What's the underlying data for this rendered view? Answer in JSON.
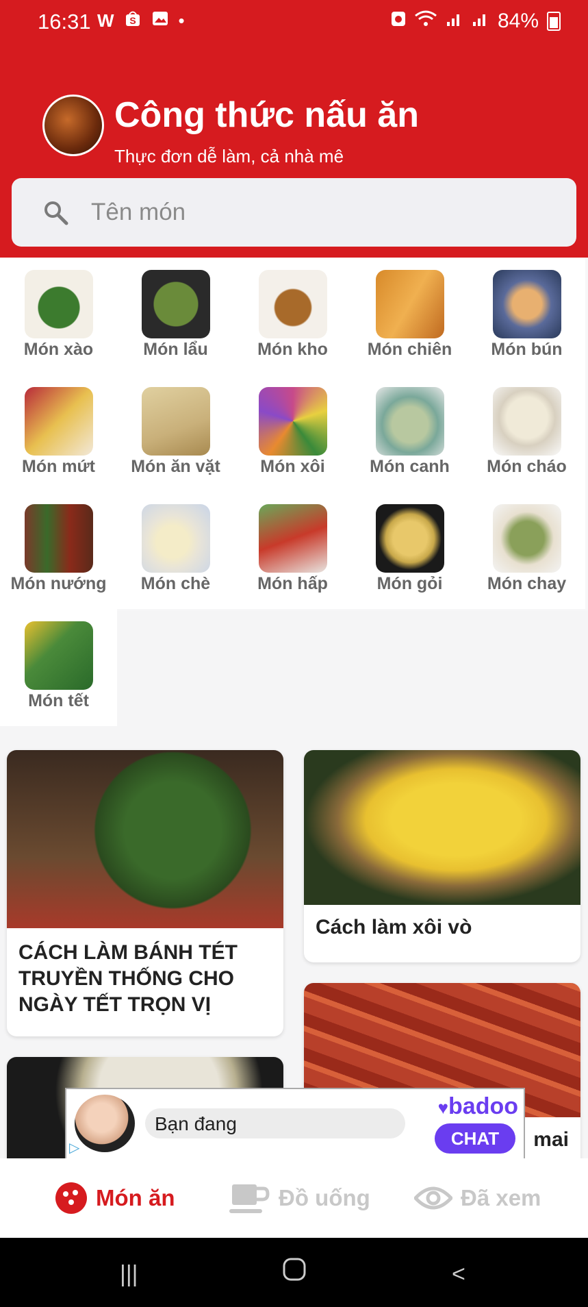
{
  "status": {
    "time": "16:31",
    "battery": "84%",
    "left_icons": [
      "W",
      "shop-icon",
      "image-icon",
      "dot-icon"
    ],
    "right_icons": [
      "alarm-icon",
      "wifi-icon",
      "signal-icon",
      "signal-icon"
    ]
  },
  "app": {
    "title": "Công thức nấu ăn",
    "subtitle": "Thực đơn dễ làm, cả nhà mê"
  },
  "search": {
    "placeholder": "Tên món"
  },
  "categories": [
    {
      "label": "Món xào",
      "color": "#3c7b2e"
    },
    {
      "label": "Món lẩu",
      "color": "#6a8b3a"
    },
    {
      "label": "Món kho",
      "color": "#a86a2a"
    },
    {
      "label": "Món chiên",
      "color": "#d88a2a"
    },
    {
      "label": "Món bún",
      "color": "#5a6a9a"
    },
    {
      "label": "Món mứt",
      "color": "#b82a3a"
    },
    {
      "label": "Món ăn vặt",
      "color": "#c9b07a"
    },
    {
      "label": "Món xôi",
      "color": "#c74a8a"
    },
    {
      "label": "Món canh",
      "color": "#7aa89a"
    },
    {
      "label": "Món cháo",
      "color": "#d8d0c0"
    },
    {
      "label": "Món nướng",
      "color": "#7a3a2a"
    },
    {
      "label": "Món chè",
      "color": "#e8e4d8"
    },
    {
      "label": "Món hấp",
      "color": "#6aa85a"
    },
    {
      "label": "Món gỏi",
      "color": "#c8a84a"
    },
    {
      "label": "Món chay",
      "color": "#8aa05a"
    },
    {
      "label": "Món tết",
      "color": "#4a8a3a"
    }
  ],
  "articles": [
    {
      "title": "CÁCH LÀM BÁNH TÉT TRUYỀN THỐNG CHO NGÀY TẾT TRỌN VỊ"
    },
    {
      "title": "Cách làm xôi vò"
    },
    {
      "title": "mai"
    }
  ],
  "ad": {
    "message": "Bạn đang",
    "brand": "badoo",
    "cta": "CHAT"
  },
  "tabs": [
    {
      "label": "Món ăn",
      "active": true,
      "color": "#d61b1f"
    },
    {
      "label": "Đồ uống",
      "active": false,
      "color": "#c8c8c8"
    },
    {
      "label": "Đã xem",
      "active": false,
      "color": "#c8c8c8"
    }
  ]
}
